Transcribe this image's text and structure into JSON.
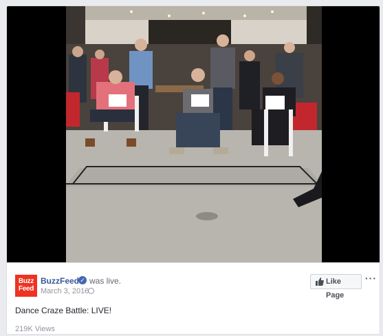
{
  "post": {
    "page_name": "BuzzFeed",
    "live_status": "was live.",
    "date": "March 3, 2016",
    "separator": "·",
    "caption": "Dance Craze Battle: LIVE!",
    "views": "219K Views",
    "like_page_label": "Like Page",
    "more_label": "···",
    "verified_mark": "✓"
  },
  "logo": {
    "line1": "Buzz",
    "line2": "Feed",
    "color": "#ee3322"
  },
  "icons": [
    "verified-icon",
    "globe-icon",
    "thumbs-up-icon",
    "more-options-icon"
  ],
  "colors": {
    "link": "#365899",
    "muted": "#90949c",
    "accent": "#4267b2"
  }
}
